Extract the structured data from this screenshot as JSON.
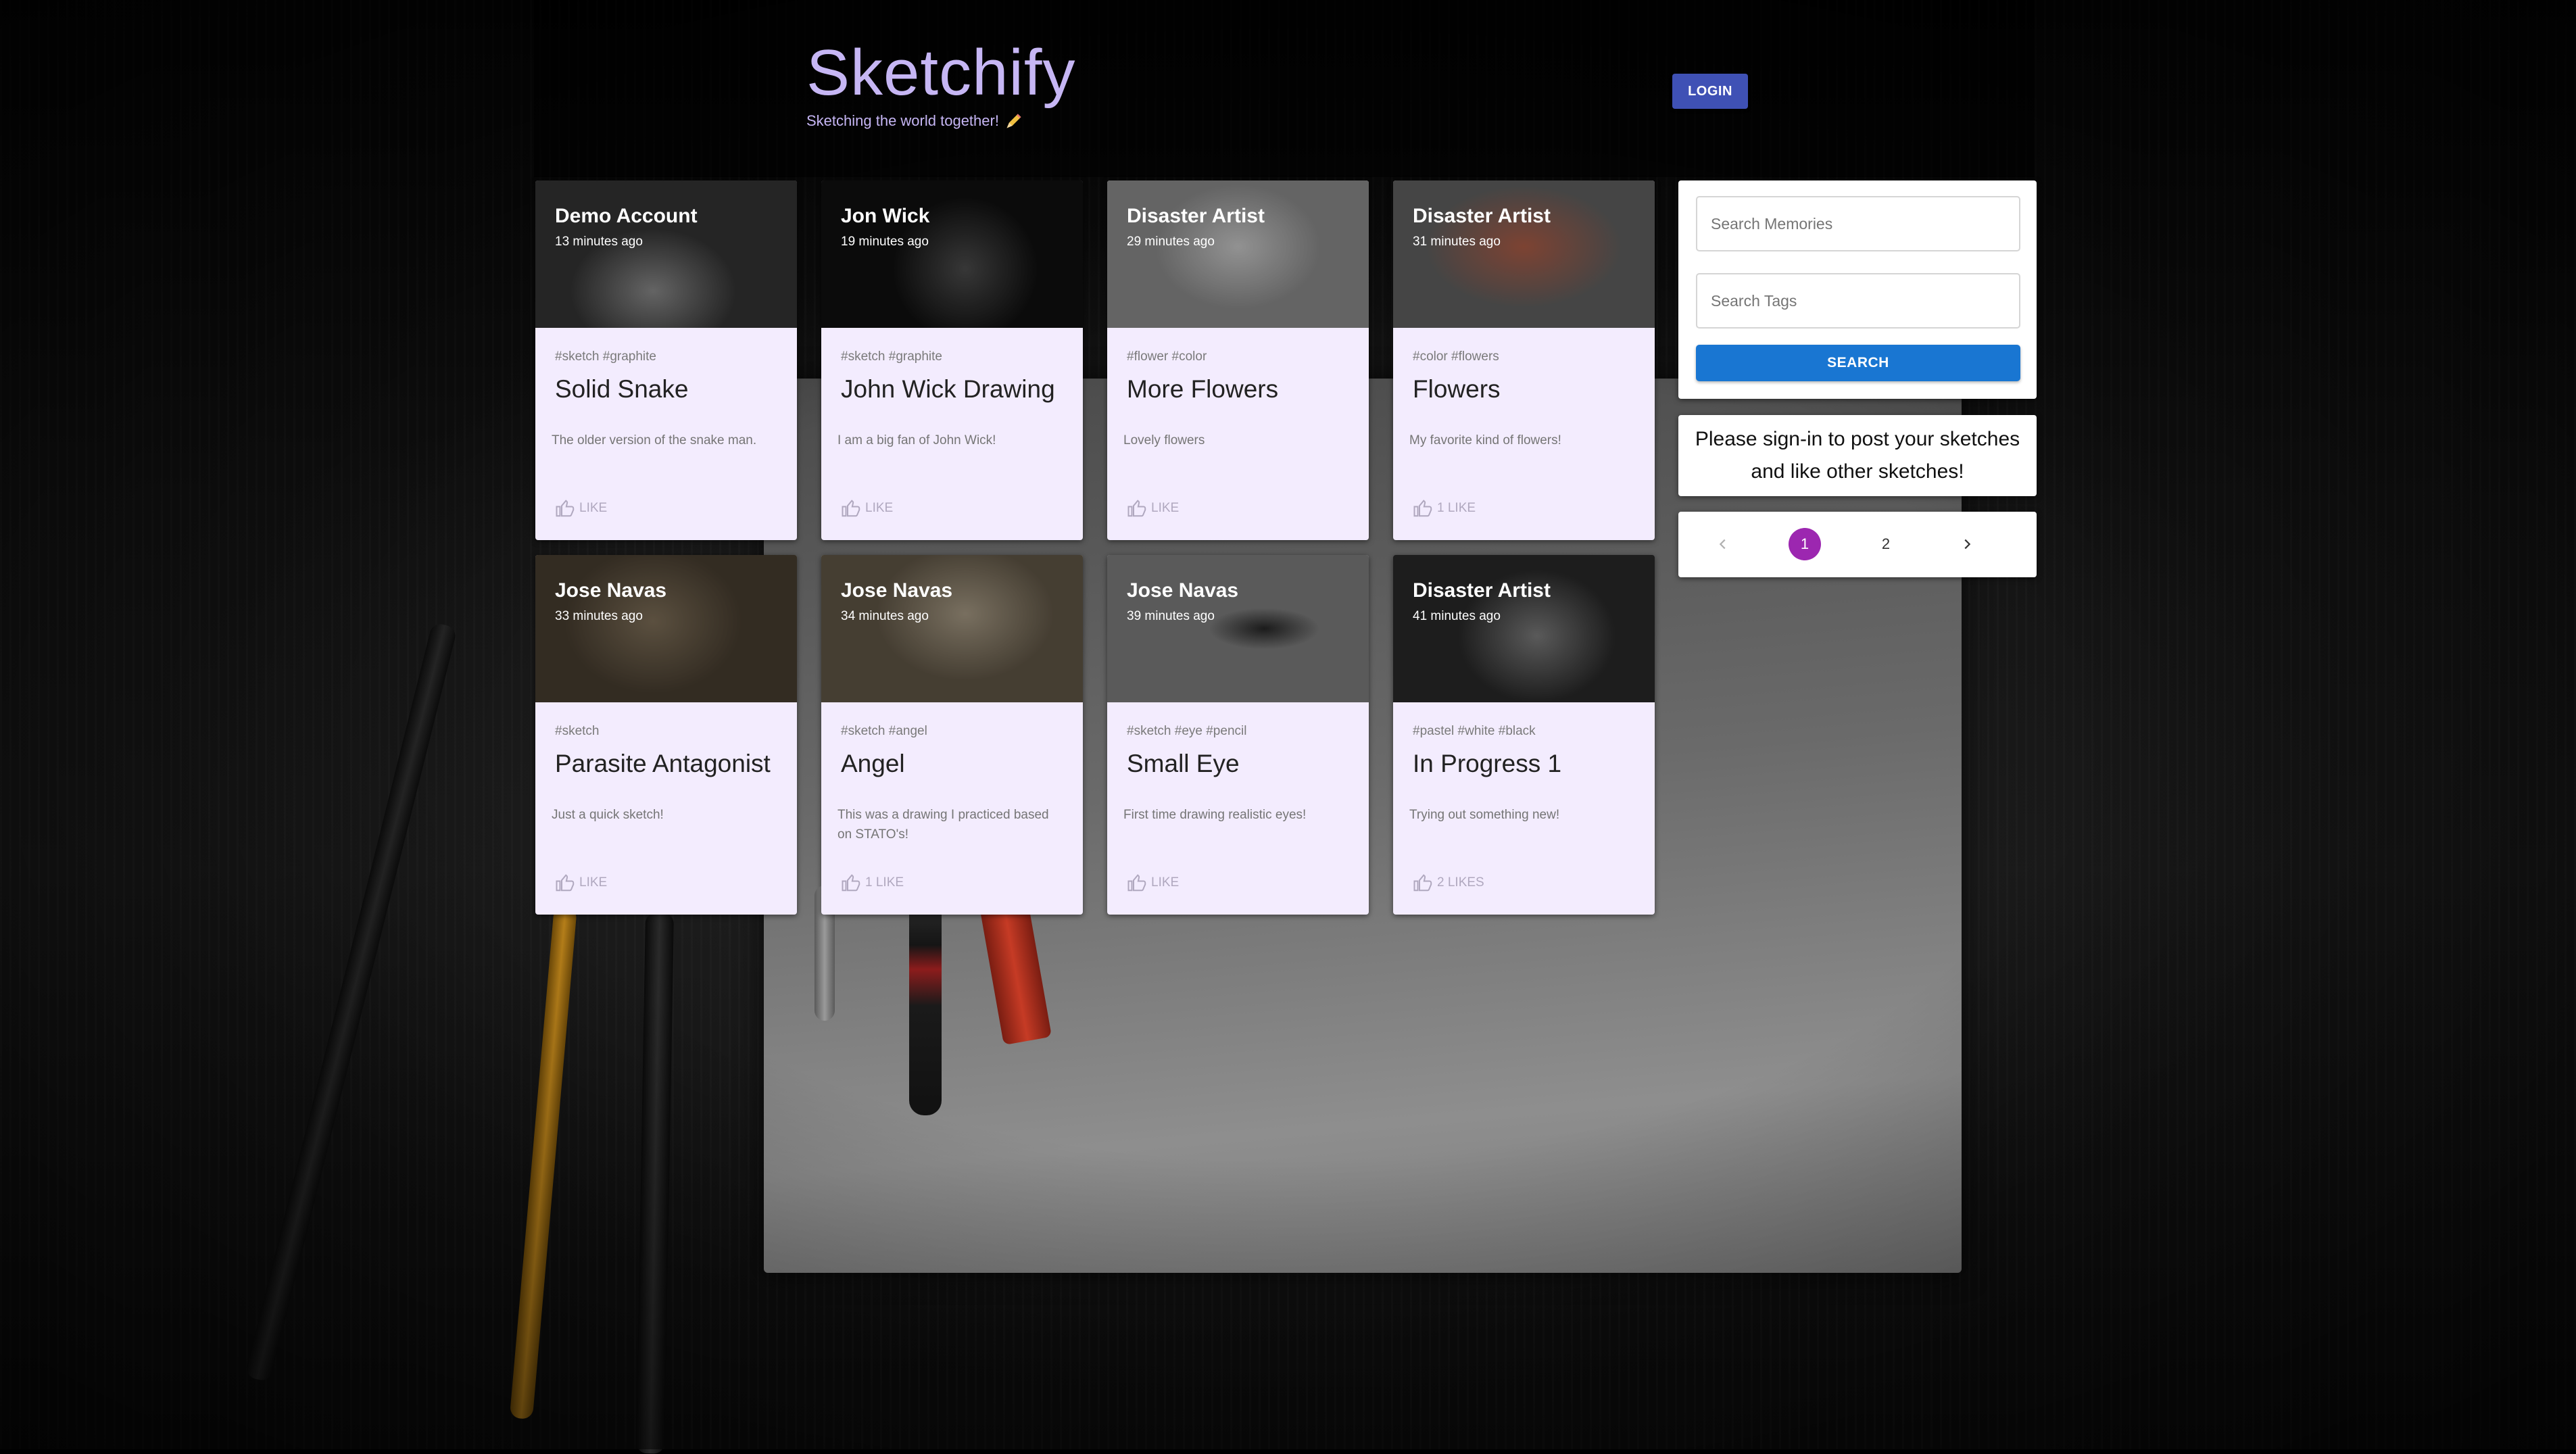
{
  "header": {
    "title": "Sketchify",
    "subtitle": "Sketching the world together!",
    "subtitle_icon": "pencil-icon",
    "login_label": "LOGIN"
  },
  "posts": [
    {
      "author": "Demo Account",
      "time": "13 minutes ago",
      "tags": "#sketch #graphite",
      "title": "Solid Snake",
      "message": "The older version of the snake man.",
      "likes": "LIKE"
    },
    {
      "author": "Jon Wick",
      "time": "19 minutes ago",
      "tags": "#sketch #graphite",
      "title": "John Wick Drawing",
      "message": "I am a big fan of John Wick!",
      "likes": "LIKE"
    },
    {
      "author": "Disaster Artist",
      "time": "29 minutes ago",
      "tags": "#flower #color",
      "title": "More Flowers",
      "message": "Lovely flowers",
      "likes": "LIKE"
    },
    {
      "author": "Disaster Artist",
      "time": "31 minutes ago",
      "tags": "#color #flowers",
      "title": "Flowers",
      "message": "My favorite kind of flowers!",
      "likes": "1 LIKE"
    },
    {
      "author": "Jose Navas",
      "time": "33 minutes ago",
      "tags": "#sketch",
      "title": "Parasite Antagonist",
      "message": "Just a quick sketch!",
      "likes": "LIKE"
    },
    {
      "author": "Jose Navas",
      "time": "34 minutes ago",
      "tags": "#sketch #angel",
      "title": "Angel",
      "message": "This was a drawing I practiced based on STATO's!",
      "likes": "1 LIKE"
    },
    {
      "author": "Jose Navas",
      "time": "39 minutes ago",
      "tags": "#sketch #eye #pencil",
      "title": "Small Eye",
      "message": "First time drawing realistic eyes!",
      "likes": "LIKE"
    },
    {
      "author": "Disaster Artist",
      "time": "41 minutes ago",
      "tags": "#pastel #white #black",
      "title": "In Progress 1",
      "message": "Trying out something new!",
      "likes": "2 LIKES"
    }
  ],
  "search": {
    "memories_placeholder": "Search Memories",
    "tags_placeholder": "Search Tags",
    "button_label": "SEARCH"
  },
  "signin_notice": "Please sign-in to post your sketches and like other sketches!",
  "pagination": {
    "pages": [
      "1",
      "2"
    ],
    "current": "1"
  },
  "colors": {
    "brand": "#c6b6f4",
    "login": "#3f51b5",
    "search": "#1976d2",
    "active_page": "#9c27b0",
    "card_bg": "#f3ecfe"
  }
}
